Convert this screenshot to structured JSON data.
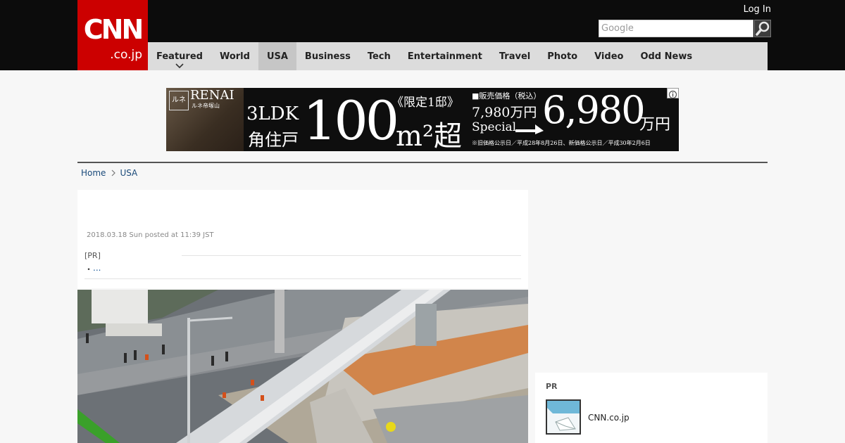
{
  "header": {
    "logo_text": "CNN",
    "logo_sub": ".co.jp",
    "login_label": "Log In",
    "search_placeholder": "Google",
    "brand_color": "#cc0000"
  },
  "nav": {
    "items": [
      {
        "label": "Featured",
        "active": false,
        "has_dropdown": true
      },
      {
        "label": "World",
        "active": false
      },
      {
        "label": "USA",
        "active": true
      },
      {
        "label": "Business",
        "active": false
      },
      {
        "label": "Tech",
        "active": false
      },
      {
        "label": "Entertainment",
        "active": false
      },
      {
        "label": "Travel",
        "active": false
      },
      {
        "label": "Photo",
        "active": false
      },
      {
        "label": "Video",
        "active": false
      },
      {
        "label": "Odd News",
        "active": false
      }
    ]
  },
  "ad_banner": {
    "brand_mark": "ルネ",
    "brand": "RENAI",
    "brand_sub": "ルネ帝塚山",
    "layout": "3LDK",
    "unit_type": "角住戸",
    "size_number": "100",
    "size_unit": "m²超",
    "limited": "《限定1邸》",
    "price_label": "■販売価格（税込）",
    "old_price": "7,980万円",
    "special_label": "Special",
    "new_price_number": "6,980",
    "new_price_unit": "万円",
    "footnote": "※旧価格公示日／平成28年8月26日、新価格公示日／平成30年2月6日"
  },
  "breadcrumb": {
    "home": "Home",
    "section": "USA"
  },
  "article": {
    "date": "2018.03.18 Sun posted at 11:39 JST",
    "pr_label": "[PR]",
    "pr_bullet": "・",
    "pr_link": "..."
  },
  "sidebar": {
    "pr_label": "PR",
    "link_text": "CNN.co.jp"
  },
  "icons": {
    "search": "magnifier-icon",
    "dropdown": "chevron-down-icon",
    "ad_choices": "adchoices-icon",
    "breadcrumb_sep": "chevron-right-icon",
    "thumbnail": "image-thumbnail-icon"
  }
}
